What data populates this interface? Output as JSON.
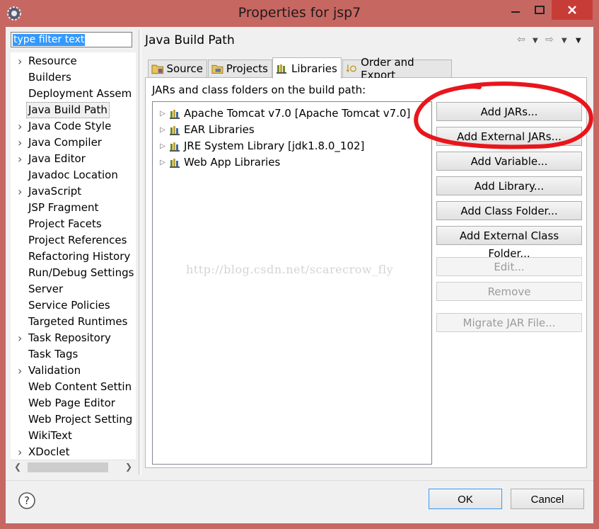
{
  "window": {
    "title": "Properties for jsp7",
    "colors": {
      "frame": "#c76762",
      "close": "#c83c38",
      "annotation": "#e8161c"
    }
  },
  "sidebar": {
    "filter_text": "type filter text",
    "items": [
      {
        "label": "Resource",
        "expandable": true
      },
      {
        "label": "Builders",
        "expandable": false
      },
      {
        "label": "Deployment Assem",
        "expandable": false
      },
      {
        "label": "Java Build Path",
        "expandable": false,
        "selected": true
      },
      {
        "label": "Java Code Style",
        "expandable": true
      },
      {
        "label": "Java Compiler",
        "expandable": true
      },
      {
        "label": "Java Editor",
        "expandable": true
      },
      {
        "label": "Javadoc Location",
        "expandable": false
      },
      {
        "label": "JavaScript",
        "expandable": true
      },
      {
        "label": "JSP Fragment",
        "expandable": false
      },
      {
        "label": "Project Facets",
        "expandable": false
      },
      {
        "label": "Project References",
        "expandable": false
      },
      {
        "label": "Refactoring History",
        "expandable": false
      },
      {
        "label": "Run/Debug Settings",
        "expandable": false
      },
      {
        "label": "Server",
        "expandable": false
      },
      {
        "label": "Service Policies",
        "expandable": false
      },
      {
        "label": "Targeted Runtimes",
        "expandable": false
      },
      {
        "label": "Task Repository",
        "expandable": true
      },
      {
        "label": "Task Tags",
        "expandable": false
      },
      {
        "label": "Validation",
        "expandable": true
      },
      {
        "label": "Web Content Settin",
        "expandable": false
      },
      {
        "label": "Web Page Editor",
        "expandable": false
      },
      {
        "label": "Web Project Setting",
        "expandable": false
      },
      {
        "label": "WikiText",
        "expandable": false
      },
      {
        "label": "XDoclet",
        "expandable": true
      }
    ]
  },
  "main": {
    "page_title": "Java Build Path",
    "tabs": [
      {
        "label": "Source",
        "icon": "source-folder-icon"
      },
      {
        "label": "Projects",
        "icon": "projects-icon"
      },
      {
        "label": "Libraries",
        "icon": "libraries-icon",
        "active": true
      },
      {
        "label": "Order and Export",
        "icon": "order-export-icon"
      }
    ],
    "libraries_label": "JARs and class folders on the build path:",
    "libraries": [
      "Apache Tomcat v7.0 [Apache Tomcat v7.0]",
      "EAR Libraries",
      "JRE System Library [jdk1.8.0_102]",
      "Web App Libraries"
    ],
    "buttons": {
      "add_jars": "Add JARs...",
      "add_external_jars": "Add External JARs...",
      "add_variable": "Add Variable...",
      "add_library": "Add Library...",
      "add_class_folder": "Add Class Folder...",
      "add_external_class_folder": "Add External Class Folder...",
      "edit": "Edit...",
      "remove": "Remove",
      "migrate_jar": "Migrate JAR File..."
    },
    "watermark": "http://blog.csdn.net/scarecrow_fly"
  },
  "footer": {
    "ok": "OK",
    "cancel": "Cancel"
  }
}
